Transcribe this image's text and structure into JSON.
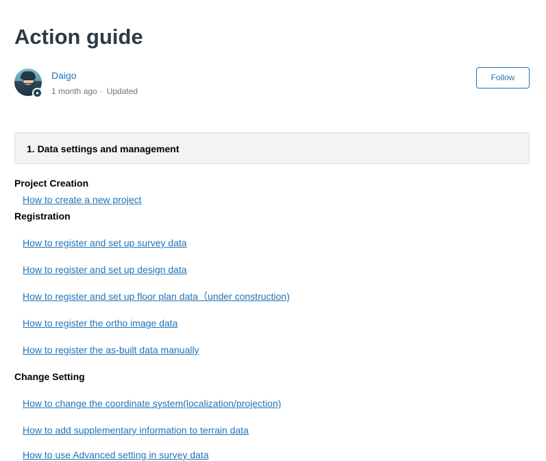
{
  "article": {
    "title": "Action guide"
  },
  "author": {
    "name": "Daigo",
    "posted": "1 month ago",
    "separator": "·",
    "status": "Updated",
    "follow_label": "Follow",
    "avatar_icon": "user-avatar-icon",
    "badge_icon": "agent-badge-icon"
  },
  "section": {
    "heading": "1. Data settings and management"
  },
  "groups": {
    "project_creation": {
      "title": "Project Creation",
      "links": [
        "How to create a new project"
      ]
    },
    "registration": {
      "title": "Registration",
      "links": [
        "How to register and set up survey data",
        "How to register and set up design data",
        "How to register and set up floor plan data（under construction)",
        "How to register the ortho image data",
        "How to register the as-built data manually"
      ]
    },
    "change_setting": {
      "title": "Change Setting",
      "links": [
        "How to change the coordinate system(localization/projection)",
        "How to add supplementary information to terrain data",
        "How to use Advanced setting in survey data"
      ]
    }
  },
  "colors": {
    "link": "#1f73b7",
    "text": "#2f3941",
    "muted": "#68737d",
    "section_bg": "#f3f3f3"
  }
}
